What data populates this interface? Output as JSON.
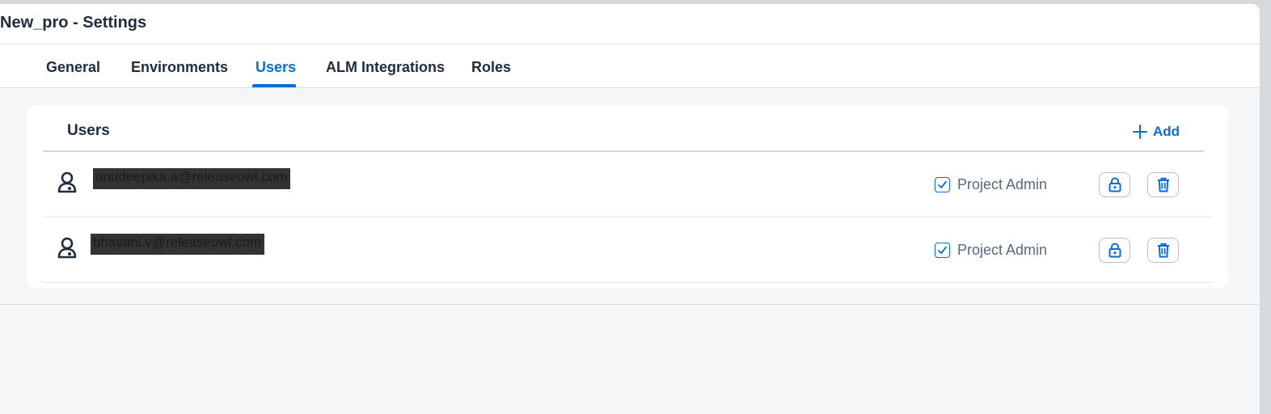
{
  "window": {
    "title": "New_pro - Settings"
  },
  "tabs": [
    {
      "label": "General",
      "active": false
    },
    {
      "label": "Environments",
      "active": false
    },
    {
      "label": "Users",
      "active": true
    },
    {
      "label": "ALM Integrations",
      "active": false
    },
    {
      "label": "Roles",
      "active": false
    }
  ],
  "users_panel": {
    "title": "Users",
    "add_label": "Add",
    "add_icon": "plus-icon",
    "users": [
      {
        "email": "anudeepika.a@releaseowl.com",
        "role": "Project Admin",
        "role_checked": true,
        "avatar_icon": "user-icon",
        "lock_icon": "lock-icon",
        "delete_icon": "trash-icon"
      },
      {
        "email": "bhavani.v@releaseowl.com",
        "role": "Project Admin",
        "role_checked": true,
        "avatar_icon": "user-icon",
        "lock_icon": "lock-icon",
        "delete_icon": "trash-icon"
      }
    ]
  },
  "colors": {
    "accent": "#0a6ed1",
    "text_dark": "#1d2d3e",
    "text_muted": "#556b82",
    "page_bg": "#f5f6f7",
    "redaction": "#333333"
  }
}
